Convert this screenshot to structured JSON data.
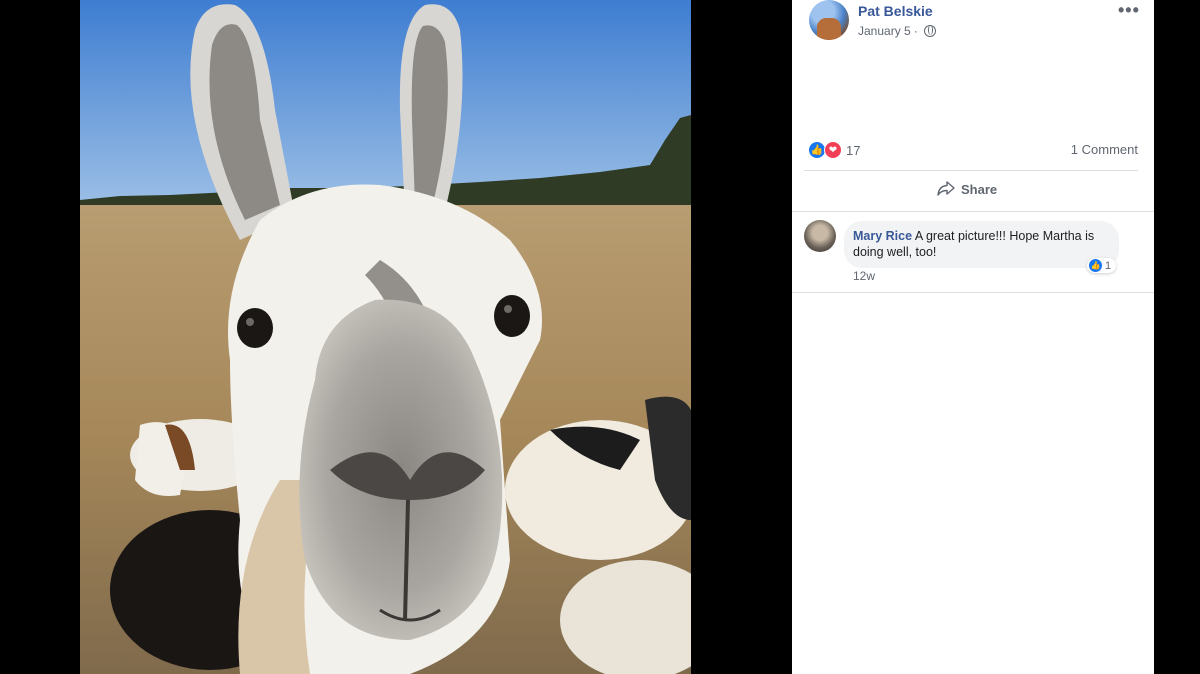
{
  "post": {
    "author": "Pat Belskie",
    "date": "January 5",
    "separator": "·",
    "more_icon": "more-horizontal-icon",
    "more_glyph": "•••",
    "reaction_count": "17",
    "comment_count": "1 Comment",
    "share_label": "Share"
  },
  "comment": {
    "author": "Mary Rice",
    "text": "A great picture!!! Hope Martha is doing well, too!",
    "time": "12w",
    "like_count": "1"
  },
  "colors": {
    "link_blue": "#385898",
    "like_blue": "#1877f2",
    "love_red": "#f33e58",
    "muted": "#606770"
  }
}
